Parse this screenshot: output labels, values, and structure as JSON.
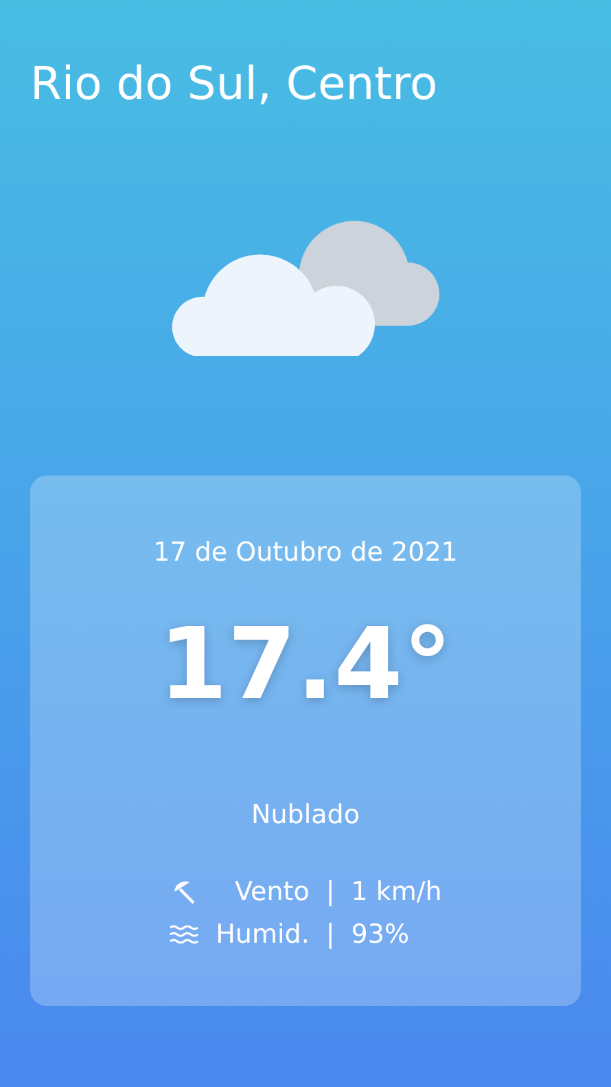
{
  "location": "Rio do Sul, Centro",
  "weather": {
    "date": "17 de Outubro de 2021",
    "temperature": "17.4°",
    "condition": "Nublado"
  },
  "details": [
    {
      "kind": "wind",
      "label": "Vento",
      "separator": "|",
      "value": "1 km/h"
    },
    {
      "kind": "humidity",
      "label": "Humid.",
      "separator": "|",
      "value": "93%"
    }
  ]
}
